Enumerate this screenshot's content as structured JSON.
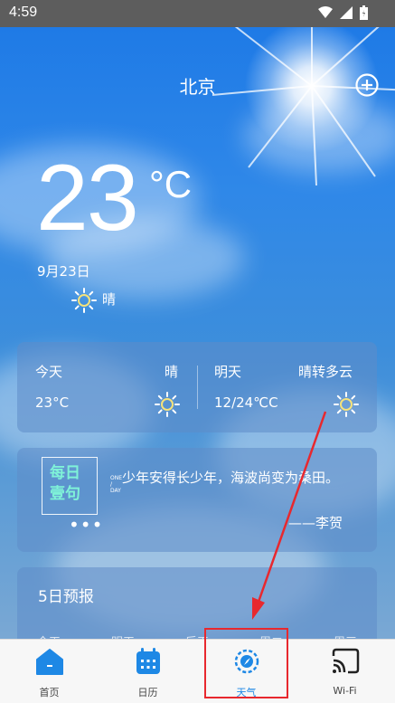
{
  "status_bar": {
    "time": "4:59"
  },
  "header": {
    "city": "北京",
    "add_icon": "add-circle-icon"
  },
  "current": {
    "temperature": "23",
    "unit": "°C",
    "date": "9月23日",
    "condition": "晴",
    "condition_icon": "sun-icon"
  },
  "forecast_card": {
    "today_label": "今天",
    "today_condition": "晴",
    "today_temp": "23°C",
    "tomorrow_label": "明天",
    "tomorrow_condition": "晴转多云",
    "tomorrow_temp": "12/24℃C"
  },
  "daily_quote": {
    "badge_line1": "每日",
    "badge_line2": "壹句",
    "badge_small": "ONE\n/\nDAY",
    "dots": "•••",
    "text": "少年安得长少年，海波尚变为桑田。",
    "author": "——李贺"
  },
  "five_day": {
    "title": "5日预报",
    "days": [
      "今天",
      "明天",
      "后天",
      "周二",
      "周三"
    ]
  },
  "nav": {
    "items": [
      {
        "label": "首页",
        "icon": "home-icon"
      },
      {
        "label": "日历",
        "icon": "calendar-icon"
      },
      {
        "label": "天气",
        "icon": "compass-icon"
      },
      {
        "label": "Wi-Fi",
        "icon": "cast-icon"
      }
    ],
    "active_index": 2
  },
  "colors": {
    "accent": "#1e88e5",
    "highlight": "#e8282e",
    "quote_accent": "#7ff2d8"
  }
}
